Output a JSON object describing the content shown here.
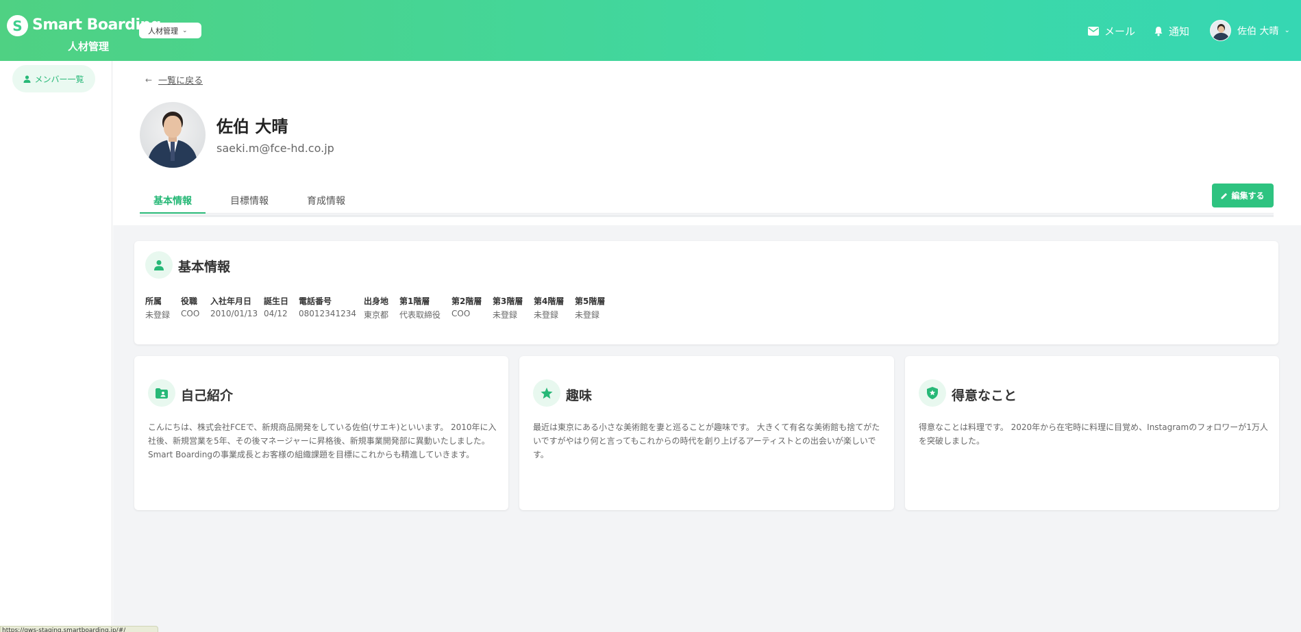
{
  "header": {
    "logo_mark": "S",
    "logo_text": "Smart Boarding",
    "logo_sub": "人材管理",
    "app_select": "人材管理",
    "mail_label": "メール",
    "notify_label": "通知",
    "user_name": "佐伯 大晴",
    "accent": "#3fd8a2"
  },
  "sidebar": {
    "items": [
      {
        "label": "メンバー一覧",
        "icon": "person-icon"
      }
    ]
  },
  "profile": {
    "back_label": "一覧に戻る",
    "name": "佐伯 大晴",
    "email": "saeki.m@fce-hd.co.jp",
    "tabs": [
      {
        "label": "基本情報",
        "active": true
      },
      {
        "label": "目標情報",
        "active": false
      },
      {
        "label": "育成情報",
        "active": false
      }
    ],
    "edit_label": "編集する"
  },
  "basic_info": {
    "title": "基本情報",
    "columns": [
      {
        "header": "所属",
        "value": "未登録"
      },
      {
        "header": "役職",
        "value": "COO"
      },
      {
        "header": "入社年月日",
        "value": "2010/01/13"
      },
      {
        "header": "誕生日",
        "value": "04/12"
      },
      {
        "header": "電話番号",
        "value": "08012341234"
      },
      {
        "header": "出身地",
        "value": "東京都"
      },
      {
        "header": "第1階層",
        "value": "代表取締役"
      },
      {
        "header": "第2階層",
        "value": "COO"
      },
      {
        "header": "第3階層",
        "value": "未登録"
      },
      {
        "header": "第4階層",
        "value": "未登録"
      },
      {
        "header": "第5階層",
        "value": "未登録"
      }
    ]
  },
  "cards": [
    {
      "title": "自己紹介",
      "icon": "folder-user-icon",
      "lines": [
        "こんにちは、株式会社FCEで、新規商品開発をしている佐伯(サエキ)といいます。 2010年に入",
        "社後、新規営業を5年、その後マネージャーに昇格後、新規事業開発部に異動いたしました。",
        "Smart Boardingの事業成長とお客様の組織課題を目標にこれからも精進していきます。"
      ]
    },
    {
      "title": "趣味",
      "icon": "star-icon",
      "lines": [
        "最近は東京にある小さな美術館を妻と巡ることが趣味です。 大きくて有名な美術館も捨てがた",
        "いですがやはり何と言ってもこれからの時代を創り上げるアーティストとの出会いが楽しいで",
        "す。"
      ]
    },
    {
      "title": "得意なこと",
      "icon": "shield-star-icon",
      "lines": [
        "得意なことは料理です。 2020年から在宅時に料理に目覚め、Instagramのフォロワーが1万人",
        "を突破しました。"
      ]
    }
  ],
  "status_bar": "https://qws-staging.smartboarding.jp/#/"
}
